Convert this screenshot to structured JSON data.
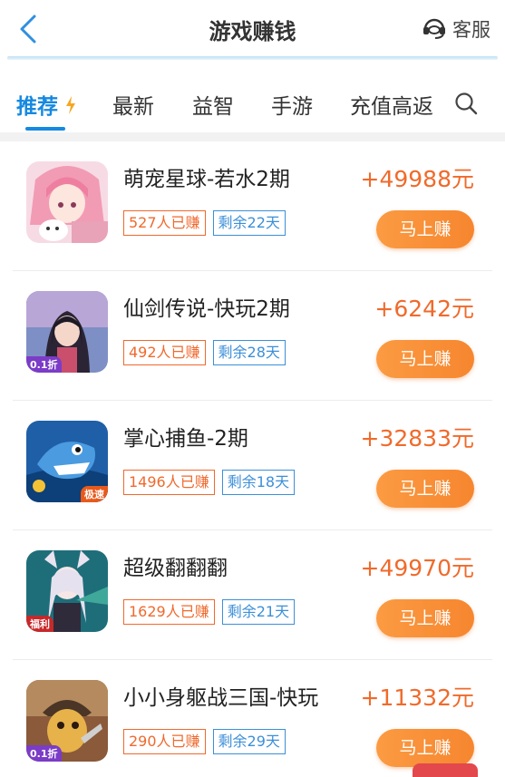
{
  "header": {
    "title": "游戏赚钱",
    "service_label": "客服"
  },
  "tabs": [
    {
      "label": "推荐",
      "active": true
    },
    {
      "label": "最新",
      "active": false
    },
    {
      "label": "益智",
      "active": false
    },
    {
      "label": "手游",
      "active": false
    },
    {
      "label": "充值高返",
      "active": false
    }
  ],
  "games": [
    {
      "name": "萌宠星球-若水2期",
      "earned": "527人已赚",
      "remaining": "剩余22天",
      "reward": "+49988元",
      "button": "马上赚",
      "badge": ""
    },
    {
      "name": "仙剑传说-快玩2期",
      "earned": "492人已赚",
      "remaining": "剩余28天",
      "reward": "+6242元",
      "button": "马上赚",
      "badge": "0.1折"
    },
    {
      "name": "掌心捕鱼-2期",
      "earned": "1496人已赚",
      "remaining": "剩余18天",
      "reward": "+32833元",
      "button": "马上赚",
      "badge": "极速"
    },
    {
      "name": "超级翻翻翻",
      "earned": "1629人已赚",
      "remaining": "剩余21天",
      "reward": "+49970元",
      "button": "马上赚",
      "badge": "福利"
    },
    {
      "name": "小小身躯战三国-快玩",
      "earned": "290人已赚",
      "remaining": "剩余29天",
      "reward": "+11332元",
      "button": "马上赚",
      "badge": "0.1折"
    }
  ],
  "colors": {
    "accent_blue": "#1689e0",
    "reward_orange": "#f06a2b",
    "button_orange": "#f7892f",
    "tag_blue": "#3c8fd8"
  }
}
